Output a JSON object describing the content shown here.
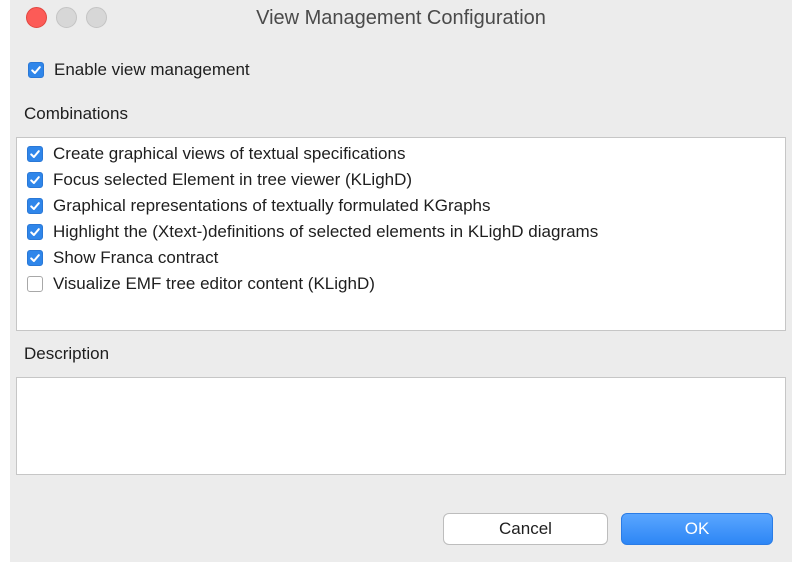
{
  "window": {
    "title": "View Management Configuration"
  },
  "enable": {
    "label": "Enable view management",
    "checked": true
  },
  "combinations": {
    "label": "Combinations",
    "items": [
      {
        "label": "Create graphical views of textual specifications",
        "checked": true
      },
      {
        "label": "Focus selected Element in tree viewer (KLighD)",
        "checked": true
      },
      {
        "label": "Graphical representations of textually formulated KGraphs",
        "checked": true
      },
      {
        "label": "Highlight the (Xtext-)definitions of selected elements in KLighD diagrams",
        "checked": true
      },
      {
        "label": "Show Franca contract",
        "checked": true
      },
      {
        "label": "Visualize EMF tree editor content  (KLighD)",
        "checked": false
      }
    ]
  },
  "description": {
    "label": "Description",
    "text": ""
  },
  "buttons": {
    "cancel_label": "Cancel",
    "ok_label": "OK"
  },
  "colors": {
    "accent": "#2f86ea",
    "close": "#fc5b57"
  }
}
